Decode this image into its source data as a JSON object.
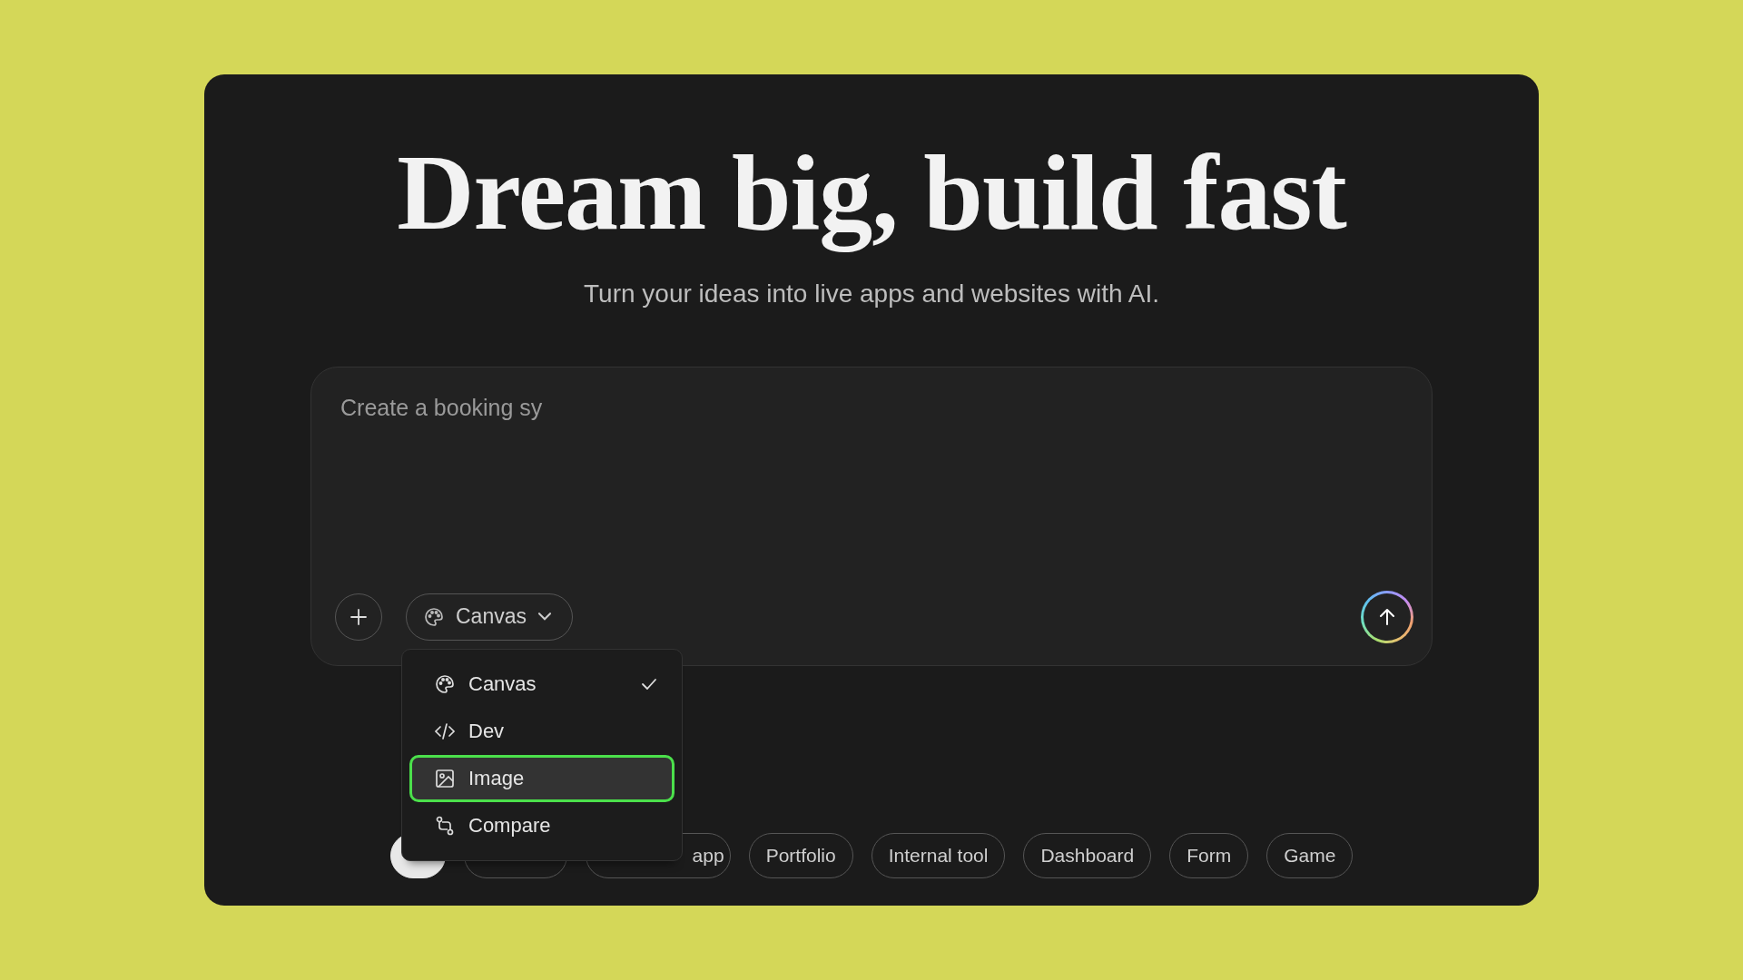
{
  "heading": "Dream big, build fast",
  "subtitle": "Turn your ideas into live apps and websites with AI.",
  "prompt": {
    "value": "Create a booking sy"
  },
  "mode_button": {
    "label": "Canvas",
    "expanded": true
  },
  "mode_menu": [
    {
      "label": "Canvas",
      "checked": true,
      "highlighted": false
    },
    {
      "label": "Dev",
      "checked": false,
      "highlighted": false
    },
    {
      "label": "Image",
      "checked": false,
      "highlighted": true
    },
    {
      "label": "Compare",
      "checked": false,
      "highlighted": false
    }
  ],
  "chips": [
    {
      "kind": "covered",
      "selected": true
    },
    {
      "kind": "covered"
    },
    {
      "kind": "partial",
      "label": "app",
      "selected": false
    },
    {
      "kind": "chip",
      "label": "Portfolio",
      "selected": false
    },
    {
      "kind": "chip",
      "label": "Internal tool",
      "selected": false
    },
    {
      "kind": "chip",
      "label": "Dashboard",
      "selected": false
    },
    {
      "kind": "chip",
      "label": "Form",
      "selected": false
    },
    {
      "kind": "chip",
      "label": "Game",
      "selected": false
    }
  ]
}
